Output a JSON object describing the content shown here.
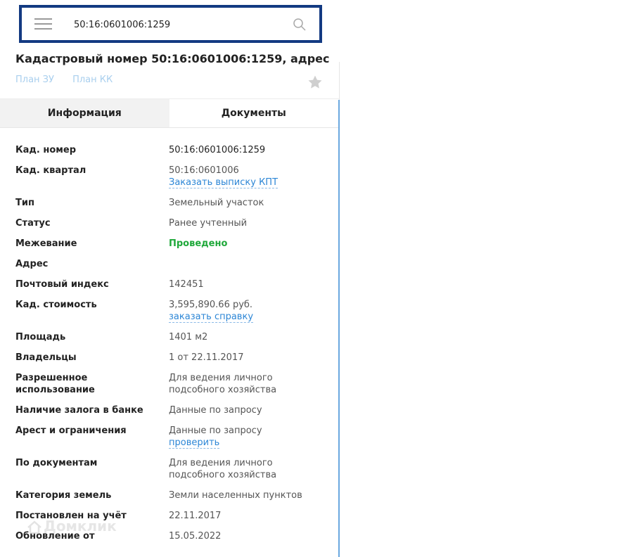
{
  "search": {
    "value": "50:16:0601006:1259",
    "placeholder": ""
  },
  "header": {
    "title": "Кадастровый номер 50:16:0601006:1259, адрес",
    "plan_links": [
      "План ЗУ",
      "План КК"
    ]
  },
  "tabs": [
    {
      "label": "Информация",
      "active": true
    },
    {
      "label": "Документы",
      "active": false
    }
  ],
  "info": {
    "cad_number": {
      "label": "Кад. номер",
      "value": "50:16:0601006:1259"
    },
    "cad_quarter": {
      "label": "Кад. квартал",
      "value": "50:16:0601006",
      "link": "Заказать выписку КПТ"
    },
    "type": {
      "label": "Тип",
      "value": "Земельный участок"
    },
    "status": {
      "label": "Статус",
      "value": "Ранее учтенный"
    },
    "survey": {
      "label": "Межевание",
      "value": "Проведено"
    },
    "address": {
      "label": "Адрес",
      "value": ""
    },
    "postal": {
      "label": "Почтовый индекс",
      "value": "142451"
    },
    "cad_cost": {
      "label": "Кад. стоимость",
      "value": "3,595,890.66 руб.",
      "link": "заказать справку"
    },
    "area": {
      "label": "Площадь",
      "value": "1401 м2"
    },
    "owners": {
      "label": "Владельцы",
      "value": "1 от 22.11.2017"
    },
    "permitted_use": {
      "label": "Разрешенное использование",
      "value": "Для ведения личного подсобного хозяйства"
    },
    "pledge": {
      "label": "Наличие залога в банке",
      "value": "Данные по запросу"
    },
    "arrest": {
      "label": "Арест и ограничения",
      "value": "Данные по запросу",
      "link": "проверить"
    },
    "by_documents": {
      "label": "По документам",
      "value": "Для ведения личного подсобного хозяйства"
    },
    "land_category": {
      "label": "Категория земель",
      "value": "Земли населенных пунктов"
    },
    "registered": {
      "label": "Постановлен на учёт",
      "value": "22.11.2017"
    },
    "updated": {
      "label": "Обновление от",
      "value": "15.05.2022"
    }
  },
  "watermark": "Домклик",
  "colors": {
    "search_border": "#133a82",
    "link": "#2c86d6",
    "plan_link": "#a9cfee",
    "success": "#1fa83a",
    "panel_border": "#6aa8e0"
  },
  "icons": {
    "menu": "hamburger-menu-icon",
    "search": "search-icon",
    "favorite": "star-icon"
  }
}
